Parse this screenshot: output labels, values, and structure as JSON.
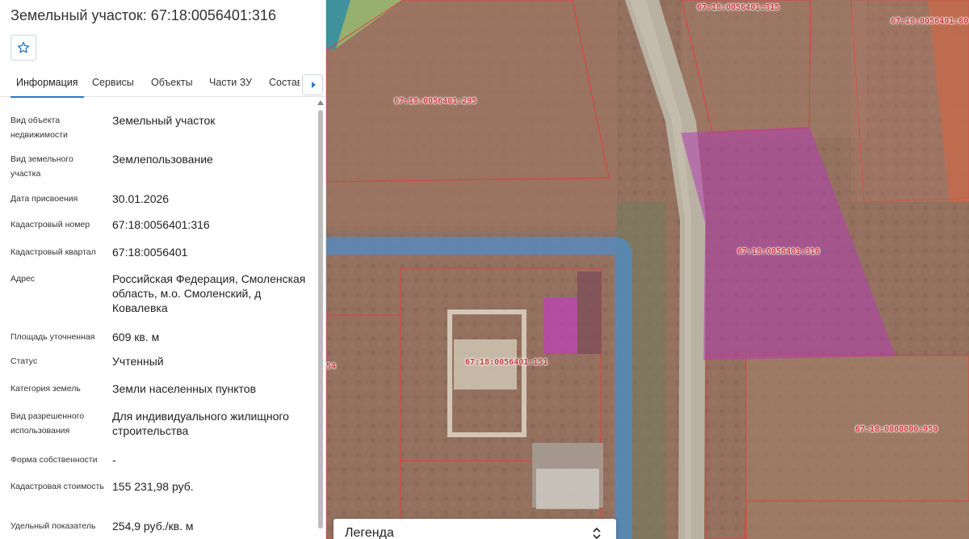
{
  "panel": {
    "title": "Земельный участок: 67:18:0056401:316",
    "favorite_icon": "star-outline-icon",
    "tabs": [
      {
        "label": "Информация",
        "active": true
      },
      {
        "label": "Сервисы",
        "active": false
      },
      {
        "label": "Объекты",
        "active": false
      },
      {
        "label": "Части ЗУ",
        "active": false
      },
      {
        "label": "Состав",
        "active": false
      }
    ],
    "tab_scroll_icon": "chevron-right-icon",
    "rows": [
      {
        "label": "Вид объекта недвижимости",
        "value": "Земельный участок"
      },
      {
        "label": "Вид земельного участка",
        "value": "Землепользование"
      },
      {
        "label": "Дата присвоения",
        "value": "30.01.2026"
      },
      {
        "label": "Кадастровый номер",
        "value": "67:18:0056401:316"
      },
      {
        "label": "Кадастровый квартал",
        "value": "67:18:0056401"
      },
      {
        "label": "Адрес",
        "value": "Российская Федерация, Смоленская область, м.о. Смоленский, д Ковалевка"
      },
      {
        "label": "Площадь уточненная",
        "value": "609 кв. м"
      },
      {
        "label": "Статус",
        "value": "Учтенный"
      },
      {
        "label": "Категория земель",
        "value": "Земли населенных пунктов"
      },
      {
        "label": "Вид разрешенного использования",
        "value": "Для индивидуального жилищного строительства"
      },
      {
        "label": "Форма собственности",
        "value": "-"
      },
      {
        "label": "Кадастровая стоимость",
        "value": "155 231,98 руб."
      },
      {
        "label": "Удельный показатель",
        "value": "254,9 руб./кв. м"
      }
    ]
  },
  "map": {
    "parcel_labels": [
      "67:18:0056401:315",
      "67:18:0056401:60",
      "67:18:0056401:295",
      "67:18:0056401:316",
      "67:18:0056401:151",
      "67:18:0000000:950",
      "54"
    ],
    "colors": {
      "parcel_border": "#e0403a",
      "selected_parcel": "#b23fb0",
      "quarter_boundary": "#4a8fd0",
      "road": "#b9b2a2"
    }
  },
  "legend": {
    "label": "Легенда",
    "toggle_icon": "chevron-up-down-icon"
  }
}
